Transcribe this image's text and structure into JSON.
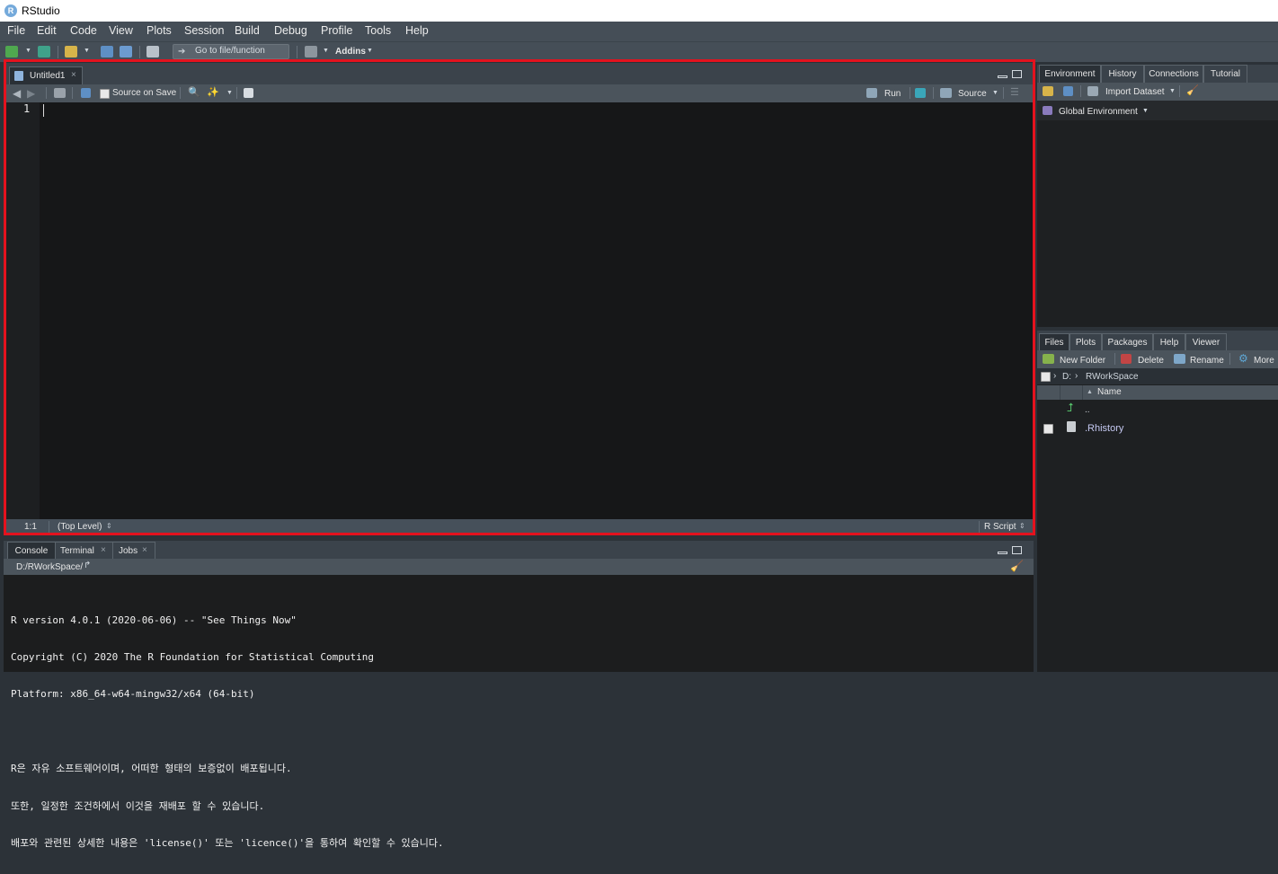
{
  "window": {
    "title": "RStudio",
    "logo_letter": "R"
  },
  "menu": [
    "File",
    "Edit",
    "Code",
    "View",
    "Plots",
    "Session",
    "Build",
    "Debug",
    "Profile",
    "Tools",
    "Help"
  ],
  "toolbar": {
    "goto_placeholder": "Go to file/function",
    "addins_label": "Addins"
  },
  "source": {
    "tab_label": "Untitled1",
    "source_on_save": "Source on Save",
    "run_label": "Run",
    "source_label": "Source",
    "line_number": "1",
    "status_position": "1:1",
    "status_scope": "(Top Level)",
    "status_filetype": "R Script"
  },
  "console": {
    "tabs": [
      "Console",
      "Terminal",
      "Jobs"
    ],
    "path": "D:/RWorkSpace/",
    "lines": [
      "R version 4.0.1 (2020-06-06) -- \"See Things Now\"",
      "Copyright (C) 2020 The R Foundation for Statistical Computing",
      "Platform: x86_64-w64-mingw32/x64 (64-bit)",
      "",
      "R은 자유 소프트웨어이며, 어떠한 형태의 보증없이 배포됩니다.",
      "또한, 일정한 조건하에서 이것을 재배포 할 수 있습니다.",
      "배포와 관련된 상세한 내용은 'license()' 또는 'licence()'을 통하여 확인할 수 있습니다."
    ]
  },
  "environment": {
    "tabs": [
      "Environment",
      "History",
      "Connections",
      "Tutorial"
    ],
    "import_label": "Import Dataset",
    "scope_label": "Global Environment"
  },
  "files": {
    "tabs": [
      "Files",
      "Plots",
      "Packages",
      "Help",
      "Viewer"
    ],
    "new_folder": "New Folder",
    "delete": "Delete",
    "rename": "Rename",
    "more": "More",
    "breadcrumb_drive": "D:",
    "breadcrumb_folder": "RWorkSpace",
    "column_name": "Name",
    "rows": [
      "..",
      ".Rhistory"
    ]
  },
  "colors": {
    "highlight": "#e4121e",
    "r_logo": "#75aadb"
  }
}
